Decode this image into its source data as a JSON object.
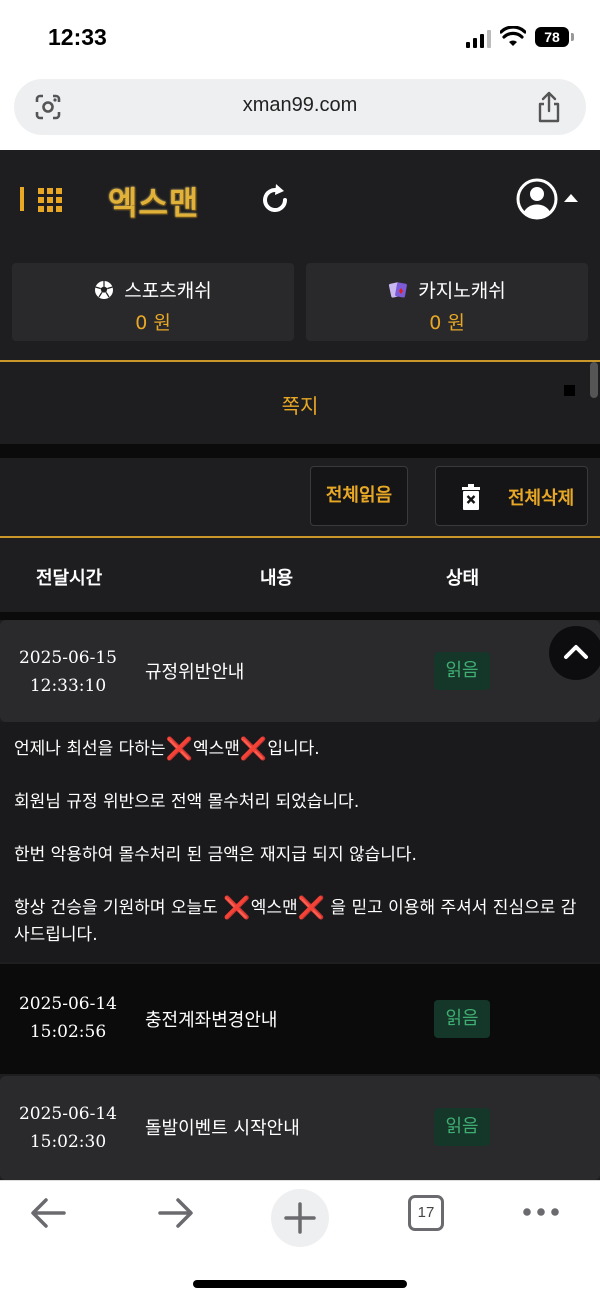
{
  "status_bar": {
    "time": "12:33",
    "battery": "78"
  },
  "browser": {
    "url": "xman99.com",
    "tab_count": "17"
  },
  "header": {
    "logo": "엑스맨"
  },
  "cash": [
    {
      "label": "스포츠캐쉬",
      "amount": "0 원",
      "icon": "soccer-ball-icon"
    },
    {
      "label": "카지노캐쉬",
      "amount": "0 원",
      "icon": "cards-icon"
    }
  ],
  "page": {
    "title": "쪽지"
  },
  "actions": {
    "read_all": "전체읽음",
    "delete_all": "전체삭제"
  },
  "table": {
    "headers": {
      "time": "전달시간",
      "content": "내용",
      "status": "상태"
    },
    "rows": [
      {
        "date": "2025-06-15",
        "time": "12:33:10",
        "subject": "규정위반안내",
        "status": "읽음",
        "expanded": true
      },
      {
        "date": "2025-06-14",
        "time": "15:02:56",
        "subject": "충전계좌변경안내",
        "status": "읽음"
      },
      {
        "date": "2025-06-14",
        "time": "15:02:30",
        "subject": "돌발이벤트 시작안내",
        "status": "읽음"
      }
    ]
  },
  "message": {
    "line1_pre": "언제나 최선을 다하는",
    "line1_brand": "엑스맨",
    "line1_post": "입니다.",
    "line2": "회원님 규정 위반으로 전액 몰수처리 되었습니다.",
    "line3": "한번 악용하여 몰수처리 된 금액은 재지급 되지 않습니다.",
    "line4_pre": "항상 건승을 기원하며 오늘도 ",
    "line4_brand": "엑스맨",
    "line4_post": " 을 믿고 이용해 주셔서 진심으로 감사드립니다.",
    "x_mark": "❌"
  },
  "colors": {
    "accent": "#e8a825",
    "status_read": "#3fae72",
    "x_mark": "#e11d1d"
  }
}
